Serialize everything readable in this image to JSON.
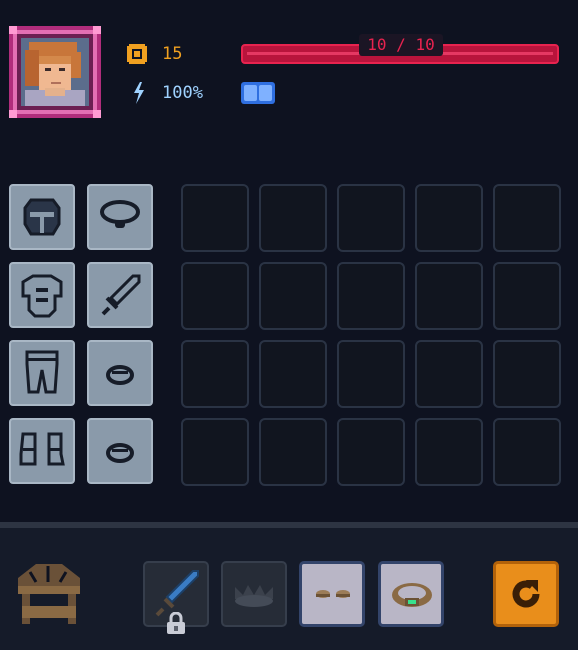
{
  "hero": {
    "gold": "15",
    "energy": "100%",
    "health_label": "10 / 10",
    "health_fraction": 1.0,
    "energy_cells_filled": 2
  },
  "equipment": [
    {
      "name": "helmet-slot",
      "icon": "helmet-icon"
    },
    {
      "name": "necklace-slot",
      "icon": "necklace-icon"
    },
    {
      "name": "armor-slot",
      "icon": "chest-armor-icon"
    },
    {
      "name": "weapon-slot",
      "icon": "sword-icon"
    },
    {
      "name": "pants-slot",
      "icon": "pants-icon"
    },
    {
      "name": "ring-slot-1",
      "icon": "ring-icon"
    },
    {
      "name": "boots-slot",
      "icon": "boots-icon"
    },
    {
      "name": "ring-slot-2",
      "icon": "ring-icon"
    }
  ],
  "inventory": {
    "rows": 4,
    "cols": 5
  },
  "bottom_bar": {
    "items": [
      "shop-icon",
      "locked-sword-icon",
      "crown-icon",
      "boots-icon",
      "ring-icon",
      "refresh-icon"
    ]
  },
  "colors": {
    "background": "#0e1220",
    "gold": "#f0a020",
    "health": "#b8143c",
    "energy": "#2f6fe0",
    "refresh_button": "#e98e1b"
  }
}
